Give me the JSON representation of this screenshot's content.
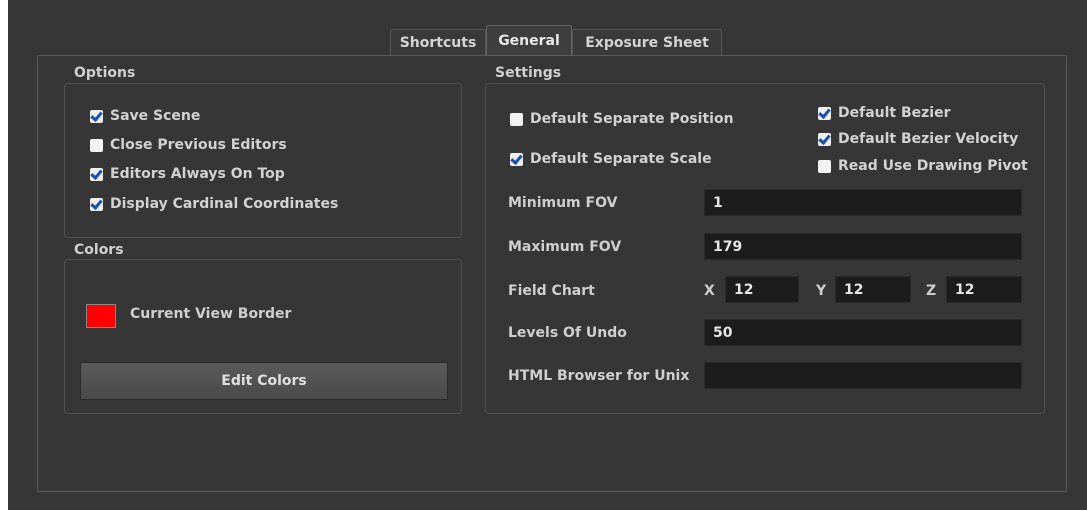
{
  "tabs": [
    "Shortcuts",
    "General",
    "Exposure Sheet"
  ],
  "active_tab": "General",
  "options": {
    "title": "Options",
    "items": [
      {
        "label": "Save Scene",
        "checked": true
      },
      {
        "label": "Close Previous Editors",
        "checked": false
      },
      {
        "label": "Editors Always On Top",
        "checked": true
      },
      {
        "label": "Display Cardinal Coordinates",
        "checked": true
      }
    ]
  },
  "colors": {
    "title": "Colors",
    "current_view_border_label": "Current View Border",
    "current_view_border_color": "#ff0000",
    "edit_button": "Edit Colors"
  },
  "settings": {
    "title": "Settings",
    "checkboxes_left": [
      {
        "label": "Default Separate Position",
        "checked": false
      },
      {
        "label": "Default Separate Scale",
        "checked": true
      }
    ],
    "checkboxes_right": [
      {
        "label": "Default Bezier",
        "checked": true
      },
      {
        "label": "Default Bezier Velocity",
        "checked": true
      },
      {
        "label": "Read Use Drawing Pivot",
        "checked": false
      }
    ],
    "minimum_fov": {
      "label": "Minimum FOV",
      "value": "1"
    },
    "maximum_fov": {
      "label": "Maximum FOV",
      "value": "179"
    },
    "field_chart": {
      "label": "Field Chart",
      "x_label": "X",
      "x": "12",
      "y_label": "Y",
      "y": "12",
      "z_label": "Z",
      "z": "12"
    },
    "levels_of_undo": {
      "label": "Levels Of Undo",
      "value": "50"
    },
    "html_browser": {
      "label": "HTML Browser for Unix",
      "value": ""
    }
  }
}
